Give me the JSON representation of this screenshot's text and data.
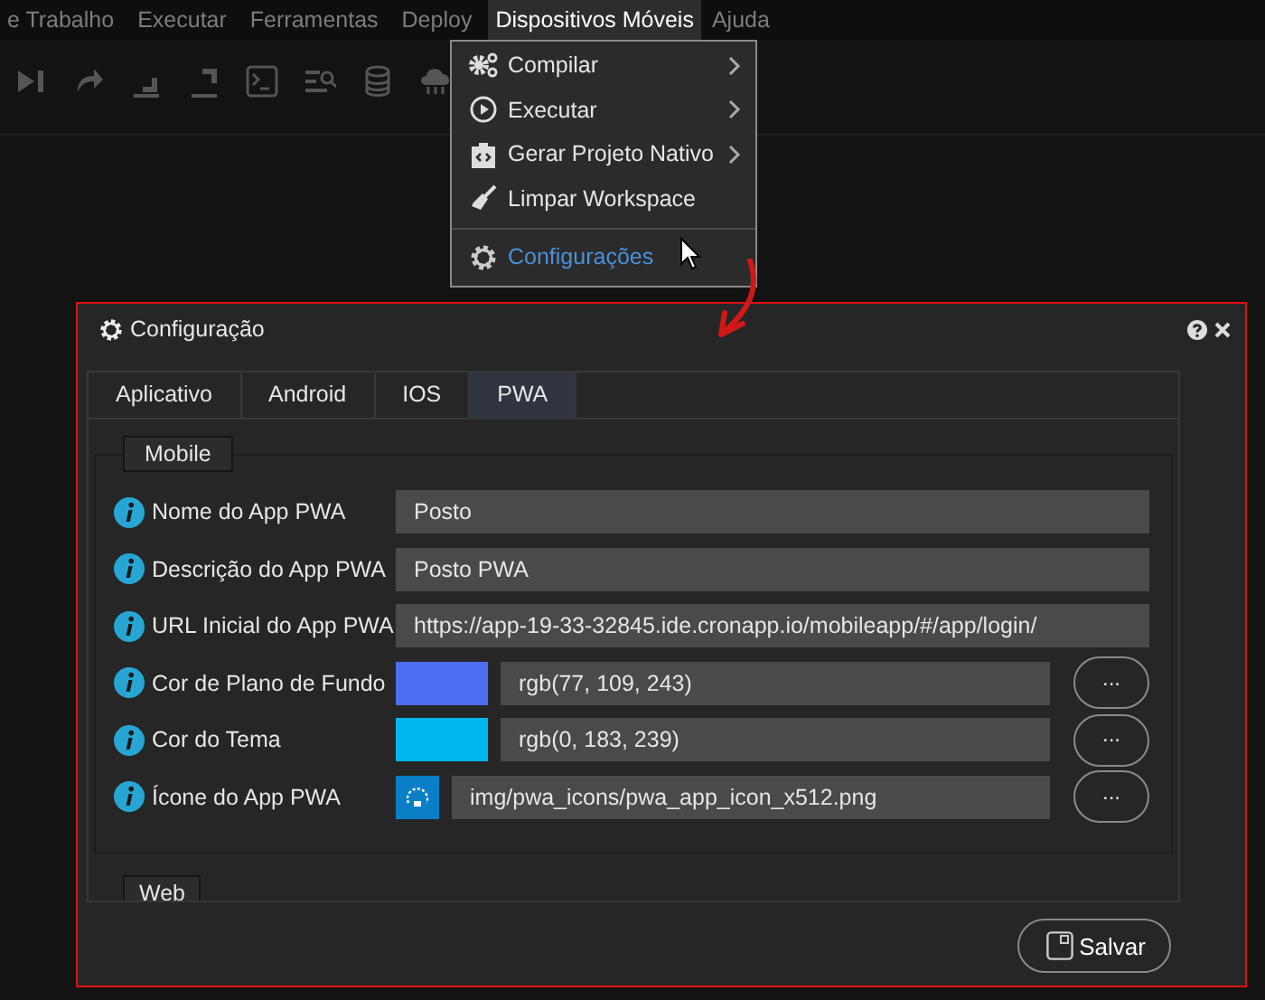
{
  "menubar": [
    {
      "label": "e Trabalho",
      "selected": false
    },
    {
      "label": "Executar",
      "selected": false
    },
    {
      "label": "Ferramentas",
      "selected": false
    },
    {
      "label": "Deploy",
      "selected": false
    },
    {
      "label": "Dispositivos Móveis",
      "selected": true
    },
    {
      "label": "Ajuda",
      "selected": false
    }
  ],
  "dropdown": [
    {
      "kind": "compile",
      "label": "Compilar",
      "submenu": true,
      "highlighted": false,
      "separator_before": false
    },
    {
      "kind": "run",
      "label": "Executar",
      "submenu": true,
      "highlighted": false,
      "separator_before": false
    },
    {
      "kind": "native",
      "label": "Gerar Projeto Nativo",
      "submenu": true,
      "highlighted": false,
      "separator_before": false
    },
    {
      "kind": "clean",
      "label": "Limpar Workspace",
      "submenu": false,
      "highlighted": false,
      "separator_before": false
    },
    {
      "kind": "settings",
      "label": "Configurações",
      "submenu": false,
      "highlighted": true,
      "separator_before": true
    }
  ],
  "dialog": {
    "title": "Configuração",
    "tabs": [
      {
        "label": "Aplicativo",
        "selected": false
      },
      {
        "label": "Android",
        "selected": false
      },
      {
        "label": "IOS",
        "selected": false
      },
      {
        "label": "PWA",
        "selected": true
      }
    ],
    "section": "Mobile",
    "fields": [
      {
        "kind": "text",
        "label": "Nome do App PWA",
        "value": "Posto"
      },
      {
        "kind": "text",
        "label": "Descrição do App PWA",
        "value": "Posto PWA"
      },
      {
        "kind": "text",
        "label": "URL Inicial do App PWA",
        "value": "https://app-19-33-32845.ide.cronapp.io/mobileapp/#/app/login/"
      },
      {
        "kind": "color",
        "label": "Cor de Plano de Fundo",
        "value": "rgb(77, 109, 243)",
        "color": "#4d6df3",
        "button": "..."
      },
      {
        "kind": "color",
        "label": "Cor do Tema",
        "value": "rgb(0, 183, 239)",
        "color": "#00b7ef",
        "button": "..."
      },
      {
        "kind": "icon",
        "label": "Ícone do App PWA",
        "value": "img/pwa_icons/pwa_app_icon_x512.png",
        "button": "..."
      }
    ],
    "next_section": "Web",
    "save_button": "Salvar"
  }
}
